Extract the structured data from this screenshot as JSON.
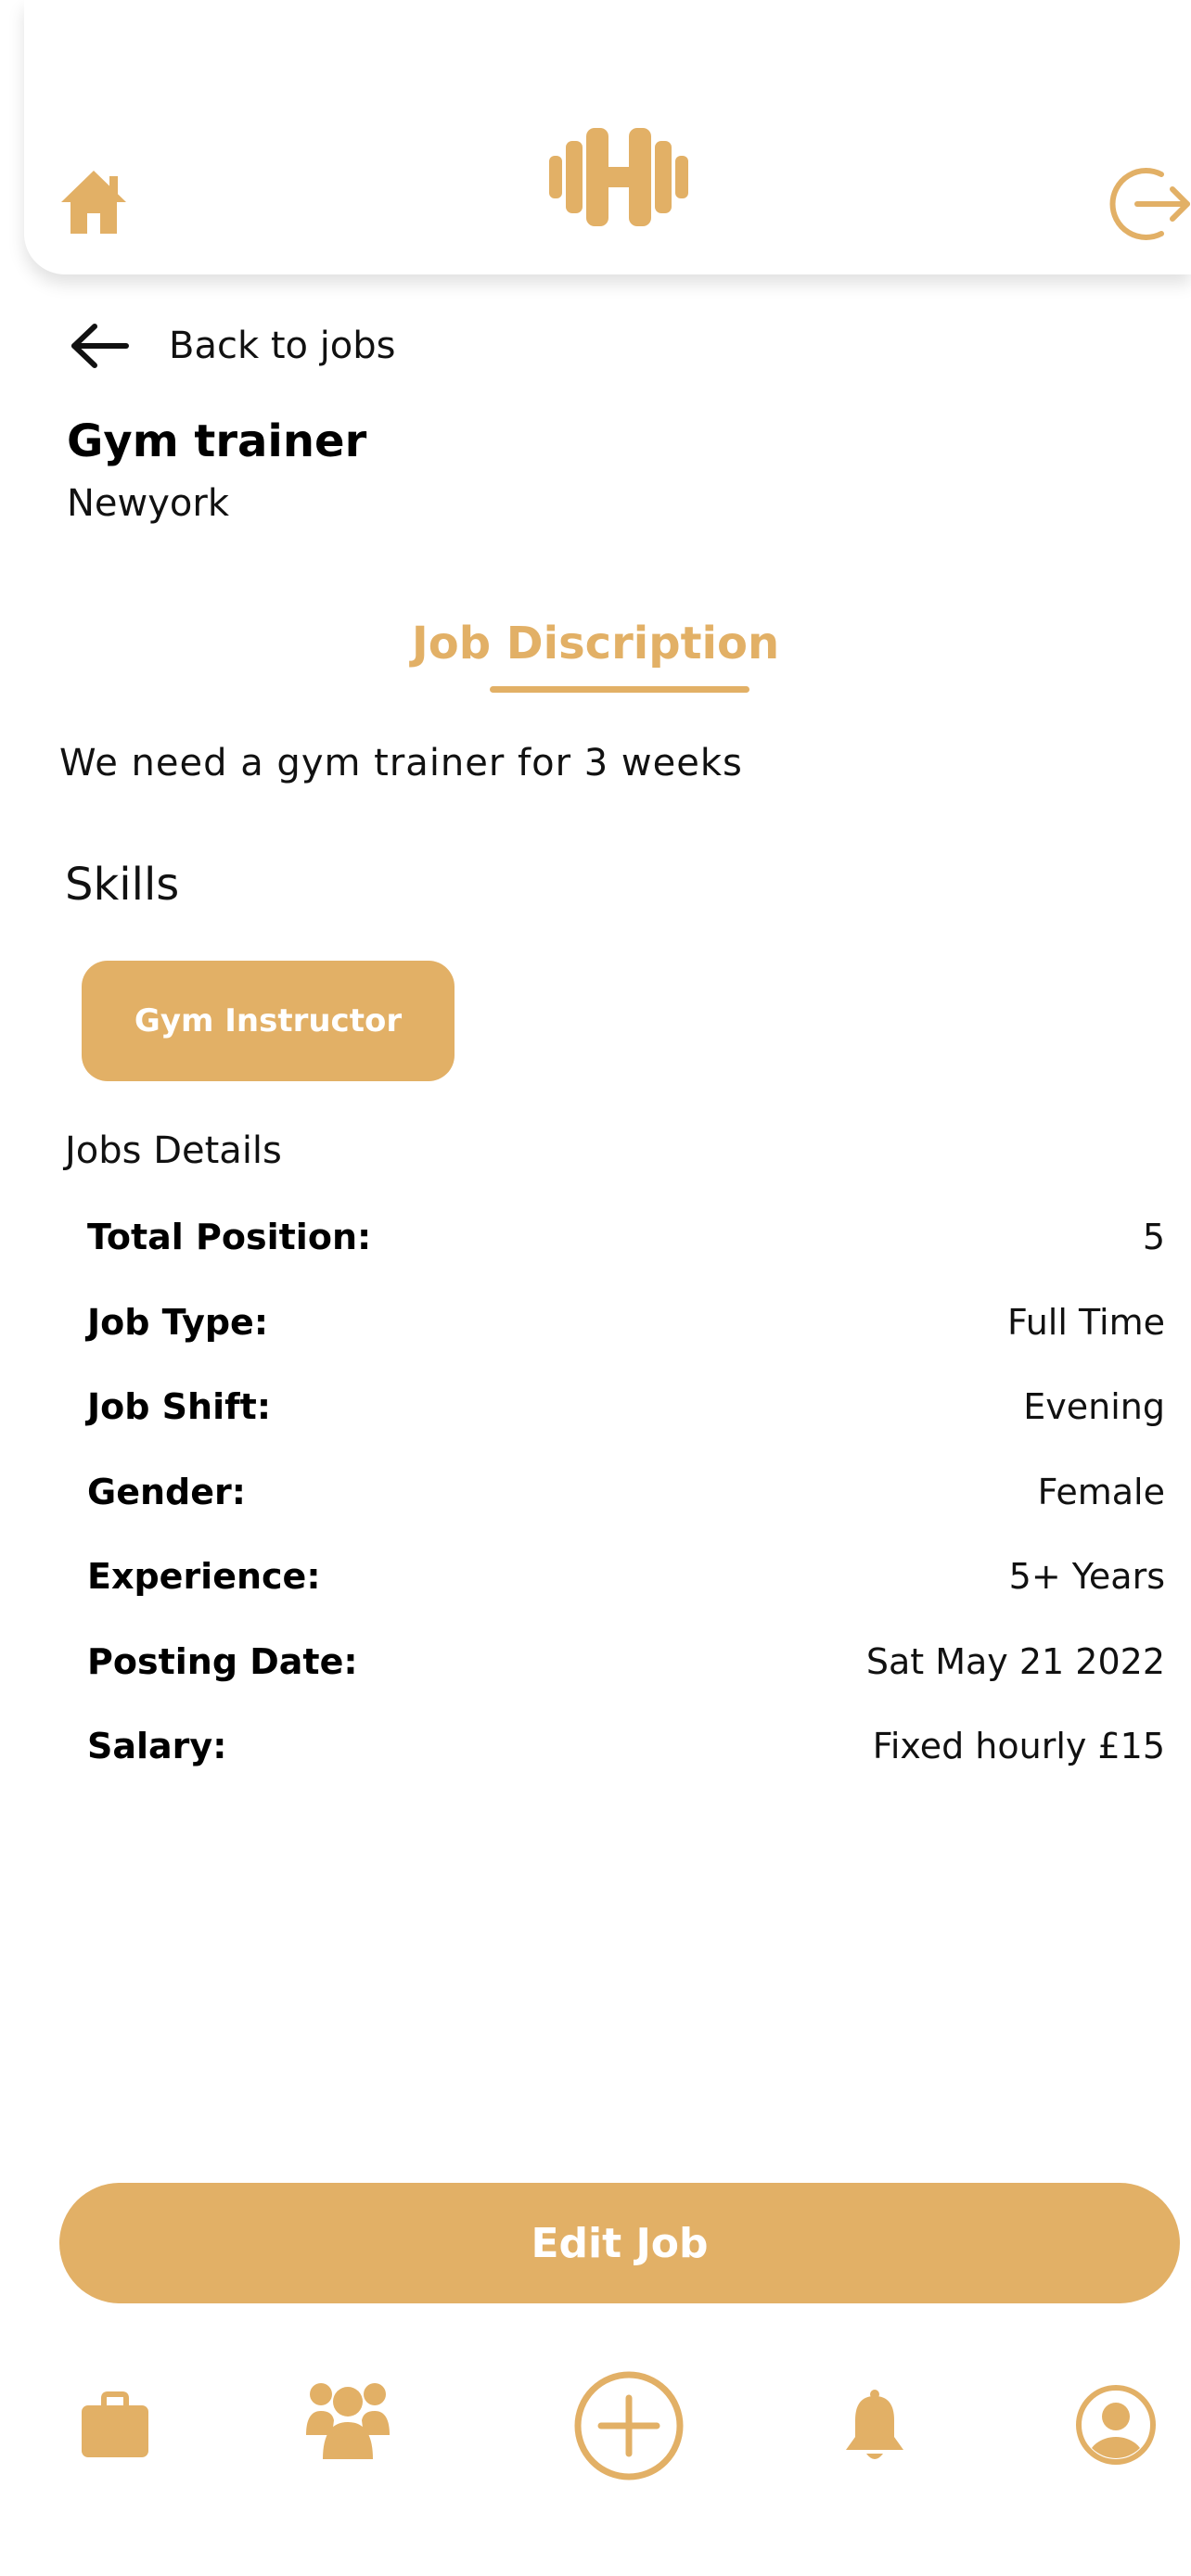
{
  "theme": {
    "accent": "#e2b066",
    "text": "#111111",
    "background": "#ffffff"
  },
  "header": {
    "left_icon": "home-icon",
    "logo_icon": "dumbbell-icon",
    "right_icon": "logout-icon"
  },
  "back": {
    "label": "Back to jobs",
    "icon": "arrow-left-icon"
  },
  "job": {
    "title": "Gym trainer",
    "location": "Newyork"
  },
  "tabs": {
    "active": "Job Discription"
  },
  "description": "We need a gym trainer for 3 weeks",
  "skills": {
    "heading": "Skills",
    "items": [
      "Gym Instructor"
    ]
  },
  "details": {
    "heading": "Jobs Details",
    "rows": [
      {
        "label": "Total Position:",
        "value": "5"
      },
      {
        "label": "Job Type:",
        "value": "Full Time"
      },
      {
        "label": "Job Shift:",
        "value": "Evening"
      },
      {
        "label": "Gender:",
        "value": "Female"
      },
      {
        "label": "Experience:",
        "value": "5+ Years"
      },
      {
        "label": "Posting Date:",
        "value": "Sat May 21 2022"
      },
      {
        "label": "Salary:",
        "value": "Fixed hourly £15"
      }
    ]
  },
  "actions": {
    "edit_label": "Edit Job"
  },
  "bottom_nav": {
    "items": [
      {
        "icon": "briefcase-icon"
      },
      {
        "icon": "users-icon"
      },
      {
        "icon": "plus-circle-icon"
      },
      {
        "icon": "bell-icon"
      },
      {
        "icon": "profile-icon"
      }
    ]
  }
}
